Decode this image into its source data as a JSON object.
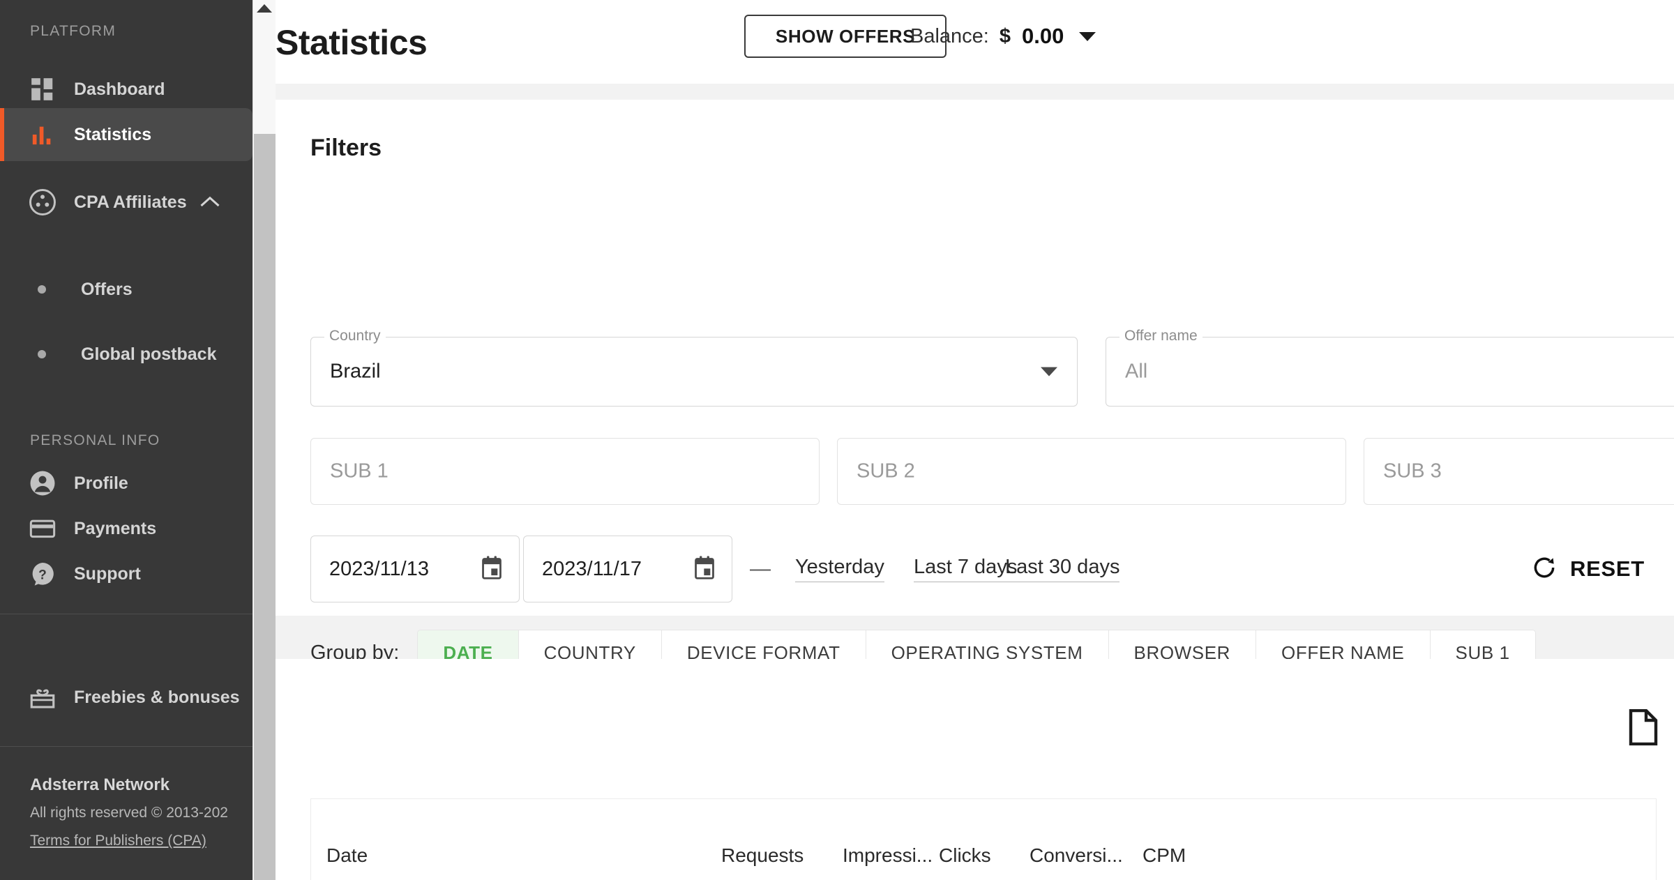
{
  "sidebar": {
    "platform_label": "PLATFORM",
    "personal_label": "PERSONAL INFO",
    "items": [
      {
        "label": "Dashboard",
        "icon": "grid-icon"
      },
      {
        "label": "Statistics",
        "icon": "bar-chart-icon"
      },
      {
        "label": "CPA Affiliates",
        "icon": "affiliates-icon"
      }
    ],
    "sub_items": [
      {
        "label": "Offers"
      },
      {
        "label": "Global postback"
      }
    ],
    "personal_items": [
      {
        "label": "Profile",
        "icon": "person-icon"
      },
      {
        "label": "Payments",
        "icon": "card-icon"
      },
      {
        "label": "Support",
        "icon": "help-icon"
      },
      {
        "label": "Freebies & bonuses",
        "icon": "gift-icon"
      }
    ],
    "footer": {
      "brand": "Adsterra Network",
      "rights": "All rights reserved © 2013-202",
      "terms": "Terms for Publishers (CPA)"
    },
    "accent": "#f05a28"
  },
  "header": {
    "title": "Statistics",
    "show_offers_label": "SHOW OFFERS",
    "balance_label": "Balance:",
    "balance_currency": "$",
    "balance_value": "0.00"
  },
  "filters": {
    "title": "Filters",
    "country": {
      "legend": "Country",
      "value": "Brazil"
    },
    "offer_name": {
      "legend": "Offer name",
      "value": "All"
    },
    "sub1_placeholder": "SUB 1",
    "sub2_placeholder": "SUB 2",
    "sub3_placeholder": "SUB 3",
    "date_from": "2023/11/13",
    "date_to": "2023/11/17",
    "date_separator": "—",
    "quick_ranges": [
      "Yesterday",
      "Last 7 days",
      "Last 30 days"
    ],
    "reset_label": "RESET"
  },
  "group_by": {
    "label": "Group by:",
    "tabs": [
      {
        "label": "DATE",
        "active": true
      },
      {
        "label": "COUNTRY",
        "active": false
      },
      {
        "label": "DEVICE FORMAT",
        "active": false
      },
      {
        "label": "OPERATING SYSTEM",
        "active": false
      },
      {
        "label": "BROWSER",
        "active": false
      },
      {
        "label": "OFFER NAME",
        "active": false
      },
      {
        "label": "SUB 1",
        "active": false
      }
    ],
    "active_color": "#4caf50"
  },
  "table": {
    "columns": [
      "Date",
      "Requests",
      "Impressi...",
      "Clicks",
      "Conversi...",
      "CPM"
    ],
    "rows": []
  },
  "widgets": {
    "chat_color": "#cc0f25"
  }
}
